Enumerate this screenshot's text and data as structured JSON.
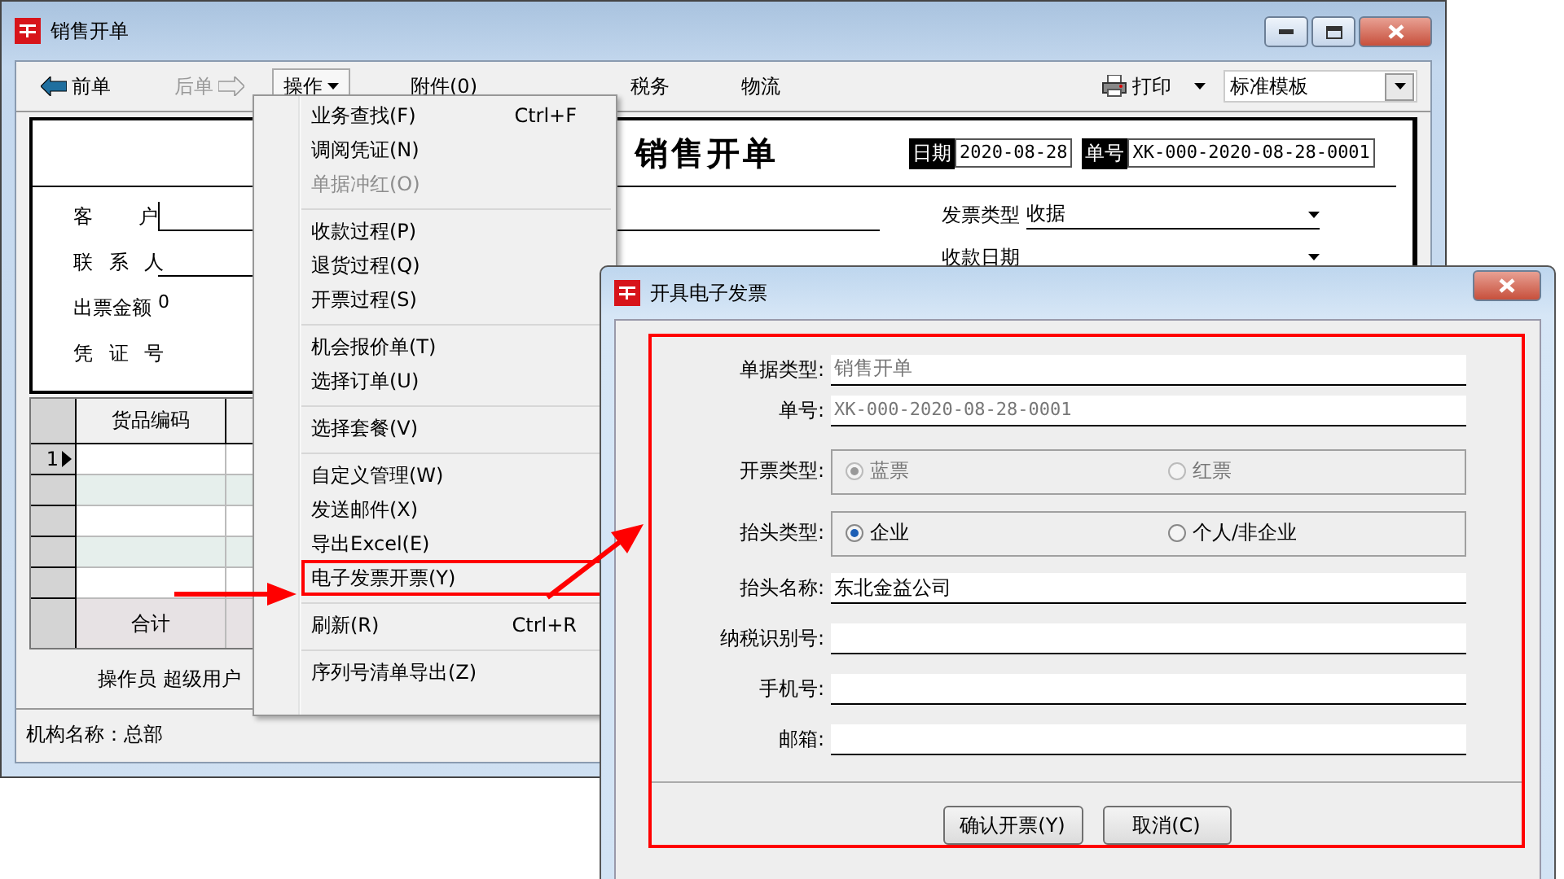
{
  "main_window": {
    "title": "销售开单"
  },
  "toolbar": {
    "items": [
      {
        "kind": "back",
        "label": "前单",
        "disabled": false,
        "open": false
      },
      {
        "kind": "forward",
        "label": "后单",
        "disabled": true,
        "open": false
      },
      {
        "kind": "menu",
        "label": "操作",
        "disabled": false,
        "open": true
      },
      {
        "kind": "plain",
        "label": "附件(0)",
        "disabled": false,
        "open": false
      },
      {
        "kind": "plain",
        "label": "税务",
        "disabled": false,
        "open": false
      },
      {
        "kind": "plain",
        "label": "物流",
        "disabled": false,
        "open": false
      }
    ],
    "print_label": "打印",
    "template": "标准模板"
  },
  "form": {
    "title": "销售开单",
    "date_label": "日期",
    "date": "2020-08-28",
    "number_label": "单号",
    "number": "XK-000-2020-08-28-0001",
    "left_fields": [
      {
        "label": "客 户",
        "kind": "line"
      },
      {
        "label": "联 系 人",
        "kind": "line"
      },
      {
        "label": "出票金额",
        "kind": "value",
        "value": "0"
      },
      {
        "label": "凭 证 号",
        "kind": "blank"
      }
    ],
    "right_fields": [
      {
        "label": "发票类型",
        "value": "收据"
      },
      {
        "label": "收款日期"
      }
    ]
  },
  "grid": {
    "columns": [
      "货品编码"
    ],
    "rows": [
      {
        "marker": "1",
        "current": true
      },
      {
        "current": false
      },
      {
        "current": false
      },
      {
        "current": false
      },
      {
        "current": false
      }
    ],
    "total_label": "合计"
  },
  "operator": {
    "label": "操作员",
    "value": "超级用户"
  },
  "status_bar": "机构名称：总部",
  "menu": {
    "items": [
      {
        "kind": "item",
        "label": "业务查找(F)",
        "shortcut": "Ctrl+F",
        "disabled": false,
        "highlighted": false
      },
      {
        "kind": "item",
        "label": "调阅凭证(N)",
        "disabled": false,
        "highlighted": false
      },
      {
        "kind": "item",
        "label": "单据冲红(O)",
        "disabled": true,
        "highlighted": false
      },
      {
        "kind": "separator"
      },
      {
        "kind": "item",
        "label": "收款过程(P)",
        "disabled": false,
        "highlighted": false
      },
      {
        "kind": "item",
        "label": "退货过程(Q)",
        "disabled": false,
        "highlighted": false
      },
      {
        "kind": "item",
        "label": "开票过程(S)",
        "disabled": false,
        "highlighted": false
      },
      {
        "kind": "separator"
      },
      {
        "kind": "item",
        "label": "机会报价单(T)",
        "disabled": false,
        "highlighted": false
      },
      {
        "kind": "item",
        "label": "选择订单(U)",
        "disabled": false,
        "highlighted": false
      },
      {
        "kind": "separator"
      },
      {
        "kind": "item",
        "label": "选择套餐(V)",
        "disabled": false,
        "highlighted": false
      },
      {
        "kind": "separator"
      },
      {
        "kind": "item",
        "label": "自定义管理(W)",
        "disabled": false,
        "highlighted": false
      },
      {
        "kind": "item",
        "label": "发送邮件(X)",
        "disabled": false,
        "highlighted": false
      },
      {
        "kind": "item",
        "label": "导出Excel(E)",
        "disabled": false,
        "highlighted": false
      },
      {
        "kind": "item",
        "label": "电子发票开票(Y)",
        "disabled": false,
        "highlighted": true
      },
      {
        "kind": "separator"
      },
      {
        "kind": "item",
        "label": "刷新(R)",
        "shortcut": "Ctrl+R",
        "disabled": false,
        "highlighted": false
      },
      {
        "kind": "separator"
      },
      {
        "kind": "item",
        "label": "序列号清单导出(Z)",
        "disabled": false,
        "highlighted": false
      }
    ]
  },
  "dialog": {
    "title": "开具电子发票",
    "rows": [
      {
        "kind": "text",
        "label": "单据类型:",
        "value": "销售开单",
        "readonly": true
      },
      {
        "kind": "code",
        "label": "单号:",
        "value": "XK-000-2020-08-28-0001",
        "readonly": true
      },
      {
        "kind": "radio",
        "label": "开票类型:",
        "disabled": true,
        "options": [
          {
            "label": "蓝票",
            "selected": true
          },
          {
            "label": "红票",
            "selected": false
          }
        ]
      },
      {
        "kind": "radio",
        "label": "抬头类型:",
        "disabled": false,
        "options": [
          {
            "label": "企业",
            "selected": true
          },
          {
            "label": "个人/非企业",
            "selected": false
          }
        ]
      },
      {
        "kind": "text",
        "label": "抬头名称:",
        "value": "东北金益公司",
        "readonly": false
      },
      {
        "kind": "text",
        "label": "纳税识别号:"
      },
      {
        "kind": "text",
        "label": "手机号:"
      },
      {
        "kind": "text",
        "label": "邮箱:"
      }
    ],
    "buttons": [
      "确认开票(Y)",
      "取消(C)"
    ]
  }
}
